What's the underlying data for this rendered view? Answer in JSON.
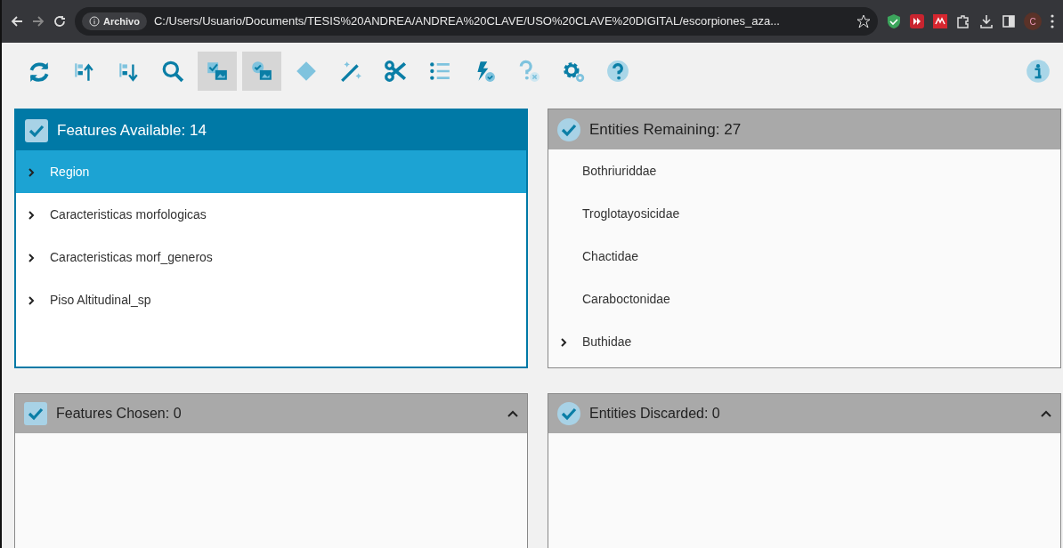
{
  "browser": {
    "security_label": "Archivo",
    "url": "C:/Users/Usuario/Documents/TESIS%20ANDREA/ANDREA%20CLAVE/USO%20CLAVE%20DIGITAL/escorpiones_aza...",
    "avatar": "C"
  },
  "toolbar": [
    {
      "kind": "refresh",
      "selected": false
    },
    {
      "kind": "sort-up",
      "selected": false
    },
    {
      "kind": "sort-down",
      "selected": false
    },
    {
      "kind": "search",
      "selected": false
    },
    {
      "kind": "image-check",
      "selected": true
    },
    {
      "kind": "image-check-round",
      "selected": true
    },
    {
      "kind": "diamond",
      "selected": false
    },
    {
      "kind": "wand",
      "selected": false
    },
    {
      "kind": "scissors",
      "selected": false
    },
    {
      "kind": "list",
      "selected": false
    },
    {
      "kind": "bolt",
      "selected": false
    },
    {
      "kind": "question-x",
      "selected": false
    },
    {
      "kind": "gears",
      "selected": false
    },
    {
      "kind": "help",
      "selected": false
    }
  ],
  "panels": [
    {
      "title": "Features Available: 14",
      "active": true,
      "kind": "square",
      "collapsible": false,
      "items": [
        {
          "label": "Region",
          "expandable": true,
          "selected": true
        },
        {
          "label": "Caracteristicas morfologicas",
          "expandable": true,
          "selected": false
        },
        {
          "label": "Caracteristicas morf_generos",
          "expandable": true,
          "selected": false
        },
        {
          "label": "Piso Altitudinal_sp",
          "expandable": true,
          "selected": false
        }
      ]
    },
    {
      "title": "Entities Remaining: 27",
      "active": false,
      "kind": "round",
      "collapsible": false,
      "items": [
        {
          "label": "Bothriuriddae",
          "expandable": false,
          "selected": false
        },
        {
          "label": "Troglotayosicidae",
          "expandable": false,
          "selected": false
        },
        {
          "label": "Chactidae",
          "expandable": false,
          "selected": false
        },
        {
          "label": "Caraboctonidae",
          "expandable": false,
          "selected": false
        },
        {
          "label": "Buthidae",
          "expandable": true,
          "selected": false
        }
      ]
    },
    {
      "title": "Features Chosen: 0",
      "active": false,
      "kind": "square",
      "collapsible": true
    },
    {
      "title": "Entities Discarded: 0",
      "active": false,
      "kind": "round",
      "collapsible": true
    }
  ]
}
